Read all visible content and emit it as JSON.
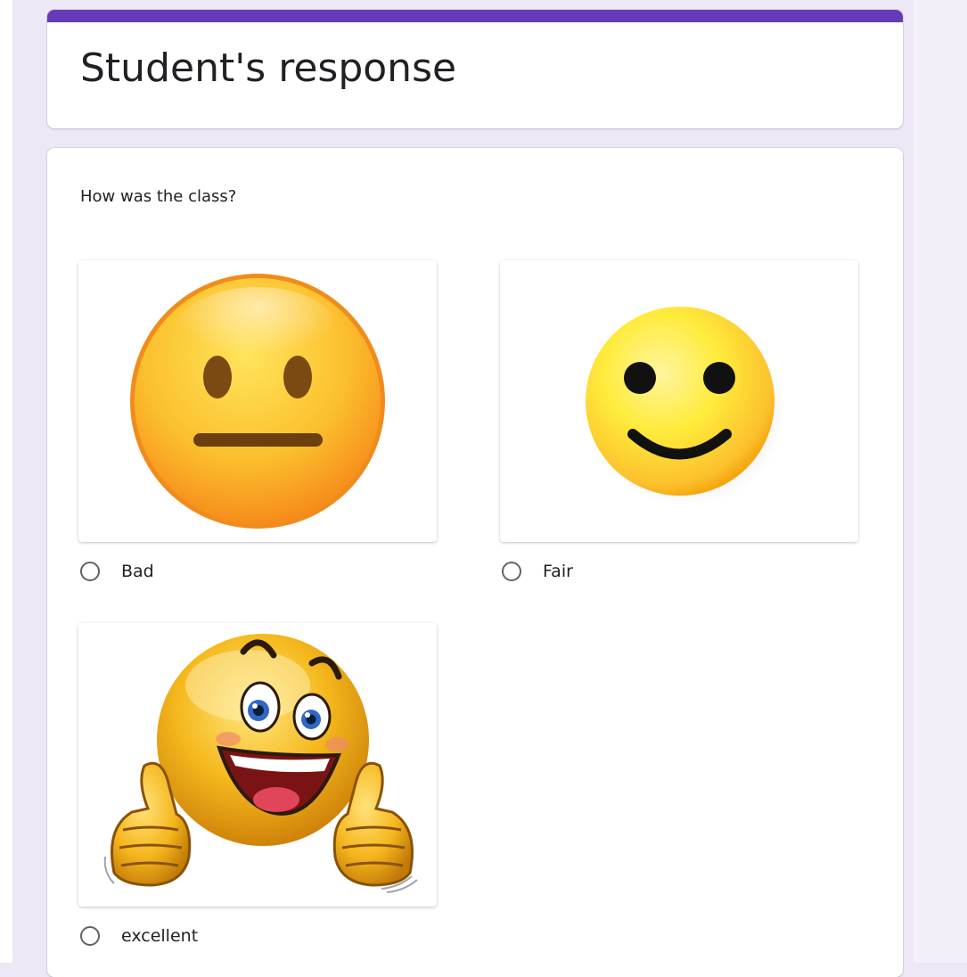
{
  "form": {
    "title": "Student's response",
    "accent_color": "#673ab7",
    "background_color": "#ede7f6"
  },
  "question": {
    "text": "How was the class?",
    "options": [
      {
        "label": "Bad",
        "image": "neutral-face-emoji",
        "selected": false
      },
      {
        "label": "Fair",
        "image": "smiley-face-emoji",
        "selected": false
      },
      {
        "label": "excellent",
        "image": "thumbs-up-smiley-emoji",
        "selected": false
      }
    ]
  }
}
